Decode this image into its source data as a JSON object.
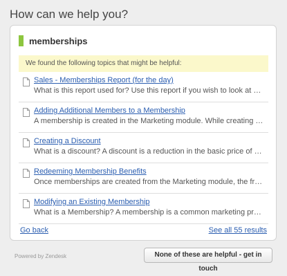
{
  "header": {
    "title": "How can we help you?"
  },
  "search": {
    "term": "memberships",
    "notice": "We found the following topics that might be helpful:"
  },
  "results": [
    {
      "title": "Sales - Memberships Report (for the day)",
      "snippet": "What is this report used for? Use this report if you wish to look at details of all me..."
    },
    {
      "title": "Adding Additional Members to a Membership",
      "snippet": "A membership is created in the Marketing module. While creating a membership, ..."
    },
    {
      "title": "Creating a Discount",
      "snippet": "What is a discount? A discount is a reduction in the basic price of any goods or s..."
    },
    {
      "title": "Redeeming Membership Benefits",
      "snippet": "Once memberships are created from the Marketing module, the front office can se..."
    },
    {
      "title": "Modifying an Existing Membership",
      "snippet": "What is a Membership? A membership is a common marketing program that all s..."
    }
  ],
  "footer": {
    "go_back": "Go back",
    "see_all": "See all 55 results",
    "powered_by": "Powered by Zendesk",
    "cta": "None of these are helpful - get in touch"
  },
  "icons": {
    "result": "document-icon"
  },
  "colors": {
    "accent_green": "#8dc63f",
    "link_blue": "#2a5db0",
    "notice_bg": "#fbf8cb"
  }
}
